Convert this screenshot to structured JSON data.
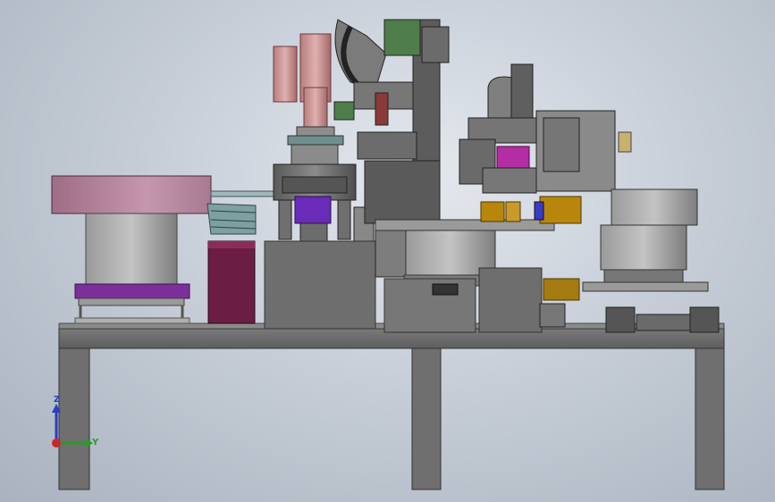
{
  "view": {
    "type": "cad-model-viewport",
    "background_top": "#e4e8ee",
    "background_bottom": "#a9b2be"
  },
  "model": {
    "colors": {
      "frame": "#6b6b6b",
      "frame_dark": "#3c3c3c",
      "bowl_top": "#b9889f",
      "bowl_base": "#8d8d8d",
      "purple_plate": "#7c2f9a",
      "maroon_box": "#6b1d44",
      "accent_purple": "#6a2bb8",
      "accent_magenta": "#b32ea4",
      "accent_gold": "#b8860b",
      "accent_green": "#4e7d4a",
      "accent_pink": "#c98f8f"
    }
  },
  "triad": {
    "axis_z_label": "Z",
    "axis_y_label": "Y",
    "z_color": "#2a3cc8",
    "y_color": "#2a9a2a",
    "x_color": "#c82828"
  }
}
